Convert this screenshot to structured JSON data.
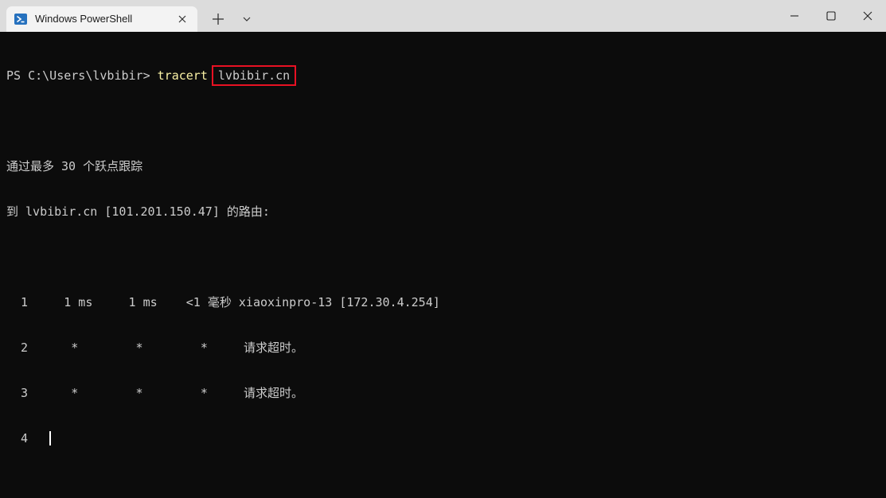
{
  "window": {
    "tab_title": "Windows PowerShell",
    "tab_icon": "powershell-icon",
    "tab_close_icon": "close-icon",
    "new_tab_icon": "plus-icon",
    "dropdown_icon": "chevron-down-icon",
    "controls": [
      "minimize-icon",
      "maximize-icon",
      "close-icon"
    ]
  },
  "terminal": {
    "prompt": "PS C:\\Users\\lvbibir> ",
    "command": "tracert",
    "argument": "lvbibir.cn",
    "header_line1": "通过最多 30 个跃点跟踪",
    "header_line2": "到 lvbibir.cn [101.201.150.47] 的路由:",
    "hops": [
      "  1     1 ms     1 ms    <1 毫秒 xiaoxinpro-13 [172.30.4.254]",
      "  2      *        *        *     请求超时。",
      "  3      *        *        *     请求超时。",
      "  4   "
    ],
    "colors": {
      "background": "#0c0c0c",
      "text": "#cccccc",
      "command": "#f9f1a5",
      "highlight_box": "#e81123"
    }
  }
}
